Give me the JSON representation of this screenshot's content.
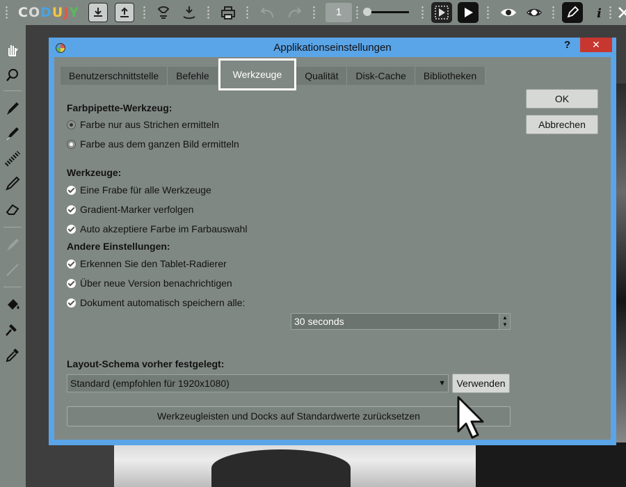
{
  "toolbar": {
    "logo": [
      "C",
      "O",
      "D",
      "U",
      "J",
      "Y"
    ],
    "page_number": "1",
    "icons": [
      "import-icon",
      "export-icon",
      "stamp-icon",
      "tool-icon",
      "print-icon",
      "undo-icon",
      "redo-icon",
      "slider-icon",
      "frames-icon",
      "play-icon",
      "eye-icon",
      "eye-hide-icon",
      "pen-icon",
      "info-icon",
      "expand-icon"
    ]
  },
  "left_panel": {
    "tools": [
      "hand-icon",
      "zoom-icon",
      "pen-icon",
      "marker-icon",
      "texture-brush-icon",
      "pencil-icon",
      "eraser-icon",
      "dimmed-brush-icon",
      "dimmed-line-icon",
      "fill-icon",
      "hammer-icon",
      "eyedropper-icon"
    ]
  },
  "dialog": {
    "title": "Applikationseinstellungen",
    "help": "?",
    "close": "✕",
    "tabs": [
      "Benutzerschnittstelle",
      "Befehle",
      "Werkzeuge",
      "Qualität",
      "Disk-Cache",
      "Bibliotheken"
    ],
    "active_tab": "Werkzeuge",
    "ok_label": "OK",
    "cancel_label": "Abbrechen",
    "eyedropper": {
      "heading": "Farbpipette-Werkzeug:",
      "options": [
        "Farbe nur aus Strichen ermitteln",
        "Farbe aus dem ganzen Bild ermitteln"
      ],
      "selected_index": 1
    },
    "tools": {
      "heading": "Werkzeuge:",
      "options": [
        "Eine Frabe für alle Werkzeuge",
        "Gradient-Marker verfolgen",
        "Auto akzeptiere Farbe im Farbauswahl"
      ]
    },
    "other": {
      "heading": "Andere Einstellungen:",
      "options": [
        "Erkennen Sie den Tablet-Radierer",
        "Über neue Version benachrichtigen",
        "Dokument automatisch speichern alle:"
      ],
      "autosave_value": "30 seconds"
    },
    "layout": {
      "heading": "Layout-Schema vorher festgelegt:",
      "selected": "Standard (empfohlen für 1920x1080)",
      "apply_label": "Verwenden",
      "reset_label": "Werkzeugleisten und Docks auf Standardwerte zurücksetzen"
    }
  },
  "colors": {
    "dialog_frame": "#5aa4e8",
    "dialog_bg": "#808884",
    "close": "#c8372f",
    "toolbar": "#7f8783"
  }
}
